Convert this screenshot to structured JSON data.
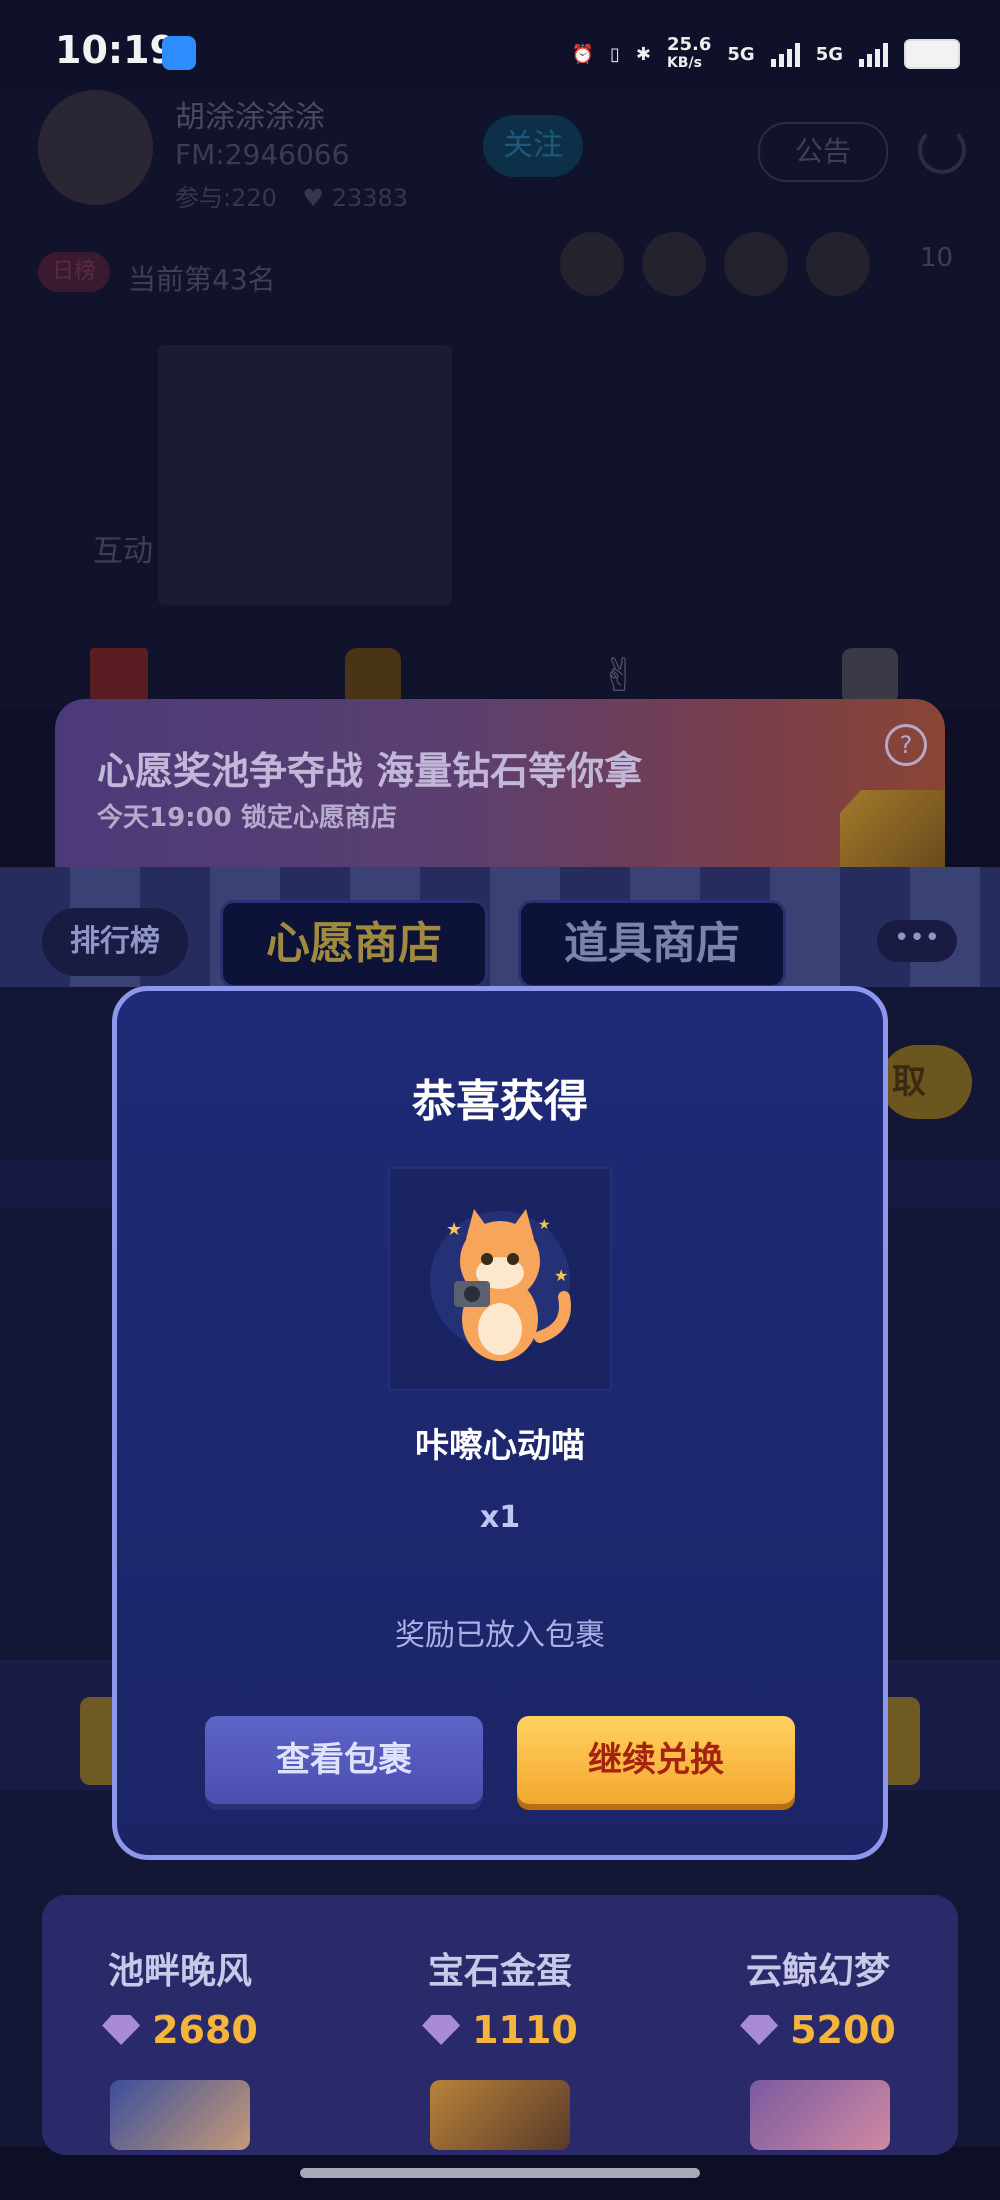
{
  "status_bar": {
    "time": "10:19",
    "net_speed": "25.6",
    "net_unit": "KB/s",
    "sim1": "5G",
    "sim2": "5G"
  },
  "room": {
    "host_name": "胡涂涂涂涂",
    "fm_id": "FM:2946066",
    "participants": "参与:220",
    "likes": "23383",
    "follow_label": "关注",
    "notice_label": "公告",
    "daily_tag": "日榜",
    "rank_text": "当前第43名",
    "fan_count": "10",
    "interact_label": "互动"
  },
  "banner": {
    "title": "心愿奖池争夺战 海量钻石等你拿",
    "subtitle": "今天19:00 锁定心愿商店",
    "help_icon": "?"
  },
  "shop_tabs": {
    "rank": "排行榜",
    "wish": "心愿商店",
    "prop": "道具商店",
    "more": "•••",
    "side": "取"
  },
  "items": [
    {
      "name": "池畔晚风",
      "price": "2680"
    },
    {
      "name": "宝石金蛋",
      "price": "1110"
    },
    {
      "name": "云鲸幻梦",
      "price": "5200"
    }
  ],
  "modal": {
    "title": "恭喜获得",
    "reward_name": "咔嚓心动喵",
    "reward_qty": "x1",
    "note": "奖励已放入包裹",
    "view_button": "查看包裹",
    "continue_button": "继续兑换"
  },
  "colors": {
    "accent_gold": "#f5b53c",
    "modal_bg": "#1f2a78",
    "modal_border": "#8d98ec",
    "continue_text": "#a4220f"
  }
}
